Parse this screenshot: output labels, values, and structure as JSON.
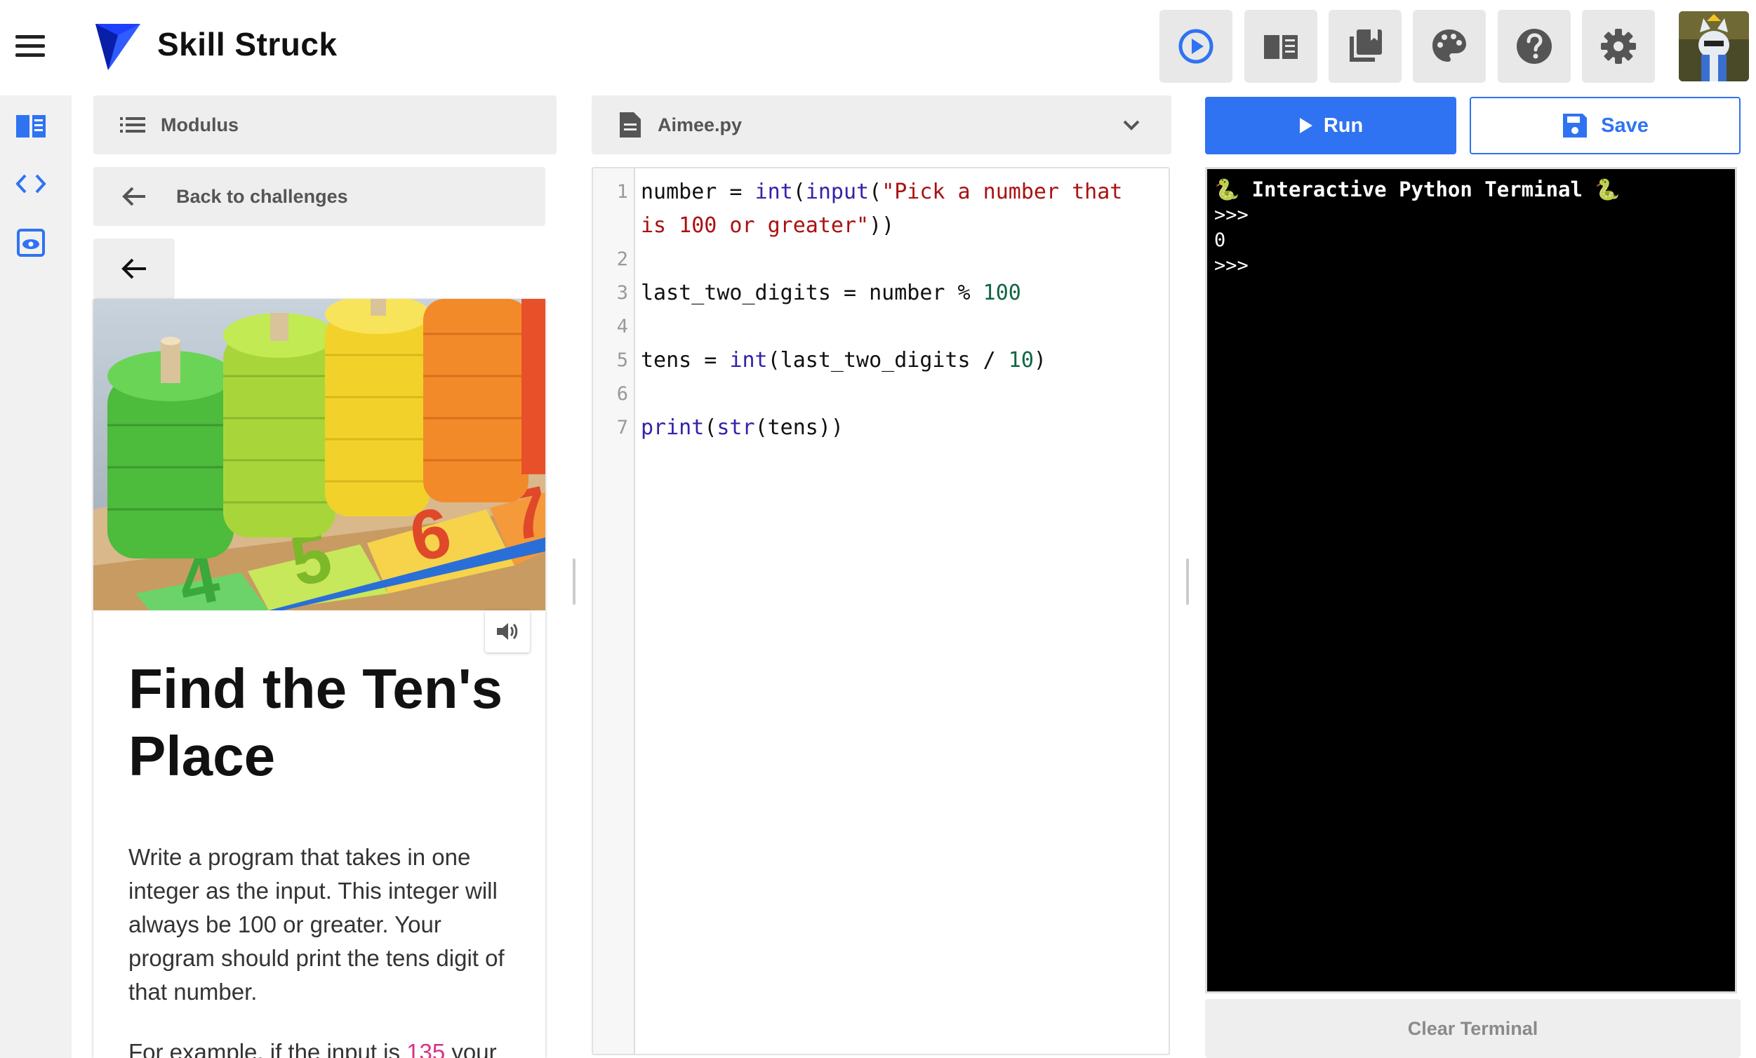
{
  "header": {
    "brand": "Skill Struck",
    "icons": [
      "play-circle-icon",
      "book-open-icon",
      "library-books-icon",
      "palette-icon",
      "help-icon",
      "settings-icon"
    ],
    "accent_color": "#2f73f2"
  },
  "rail": {
    "icons": [
      "book-icon",
      "code-icon",
      "preview-eye-icon"
    ]
  },
  "lesson": {
    "section_label": "Modulus",
    "back_label": "Back to challenges",
    "title": "Find the Ten's Place",
    "body": "Write a program that takes in one integer as the input. This integer will always be 100 or greater. Your program should print the tens digit of that number.",
    "example_prefix": "For example, if the input is ",
    "example_number": "135",
    "example_suffix": " your"
  },
  "editor": {
    "filename": "Aimee.py",
    "line_numbers": [
      "1",
      "2",
      "3",
      "4",
      "5",
      "6",
      "7"
    ]
  },
  "actions": {
    "run_label": "Run",
    "save_label": "Save",
    "clear_label": "Clear Terminal"
  },
  "terminal": {
    "title": "🐍 Interactive Python Terminal 🐍",
    "lines": [
      ">>>",
      "0",
      ">>>"
    ]
  }
}
